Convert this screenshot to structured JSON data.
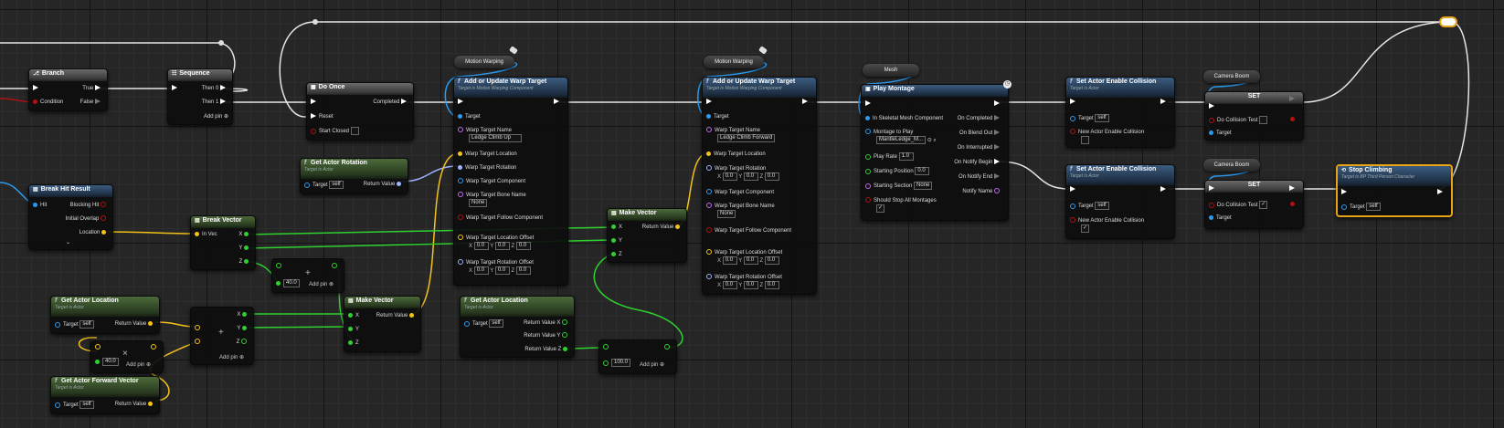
{
  "colors": {
    "exec": "#ffffff",
    "object": "#2a9bf0",
    "bool": "#b01212",
    "vector": "#f2c21b",
    "float": "#2fd12f",
    "rotator": "#a0b4ff",
    "name": "#c06cf0",
    "struct": "#2a9bf0",
    "selected": "#e8a317"
  },
  "nodes": {
    "branch": {
      "title": "Branch",
      "pins": {
        "true": "True",
        "false": "False",
        "condition": "Condition"
      }
    },
    "sequence": {
      "title": "Sequence",
      "pins": {
        "then0": "Then 0",
        "then1": "Then 1"
      },
      "add_pin": "Add pin"
    },
    "do_once": {
      "title": "Do Once",
      "pins": {
        "completed": "Completed",
        "reset": "Reset",
        "start_closed": "Start Closed"
      }
    },
    "break_hit": {
      "title": "Break Hit Result",
      "pins": {
        "hit": "Hit",
        "blocking": "Blocking Hit",
        "overlap": "Initial Overlap",
        "location": "Location"
      }
    },
    "break_vector": {
      "title": "Break Vector",
      "pins": {
        "in_vec": "In Vec",
        "x": "X",
        "y": "Y",
        "z": "Z"
      }
    },
    "get_rotation": {
      "title": "Get Actor Rotation",
      "subtitle": "Target is Actor",
      "pins": {
        "target": "Target",
        "target_val": "self",
        "ret": "Return Value"
      }
    },
    "add_float": {
      "value": "40.0",
      "add_pin": "Add pin"
    },
    "get_location": {
      "title": "Get Actor Location",
      "subtitle": "Target is Actor",
      "pins": {
        "target": "Target",
        "target_val": "self",
        "ret": "Return Value"
      }
    },
    "add_vector": {
      "glyph": "+",
      "pins": {
        "x": "X",
        "y": "Y",
        "z": "Z"
      },
      "add_pin": "Add pin"
    },
    "mul_float": {
      "value": "40.0",
      "add_pin": "Add pin"
    },
    "get_forward": {
      "title": "Get Actor Forward Vector",
      "subtitle": "Target is Actor",
      "pins": {
        "target": "Target",
        "target_val": "self",
        "ret": "Return Value"
      }
    },
    "make_vector1": {
      "title": "Make Vector",
      "pins": {
        "x": "X",
        "y": "Y",
        "z": "Z",
        "ret": "Return Value"
      }
    },
    "motion1": {
      "label": "Motion Warping"
    },
    "warp1": {
      "title": "Add or Update Warp Target",
      "subtitle": "Target is Motion Warping Component",
      "pins": {
        "target": "Target",
        "name_lbl": "Warp Target Name",
        "name_val": "Ledge Climb Up",
        "loc": "Warp Target Location",
        "rot": "Warp Target Rotation",
        "comp": "Warp Target Component",
        "bone_lbl": "Warp Target Bone Name",
        "bone_val": "None",
        "follow": "Warp Target Follow Component",
        "loc_off": "Warp Target Location Offset",
        "rot_off": "Warp Target Rotation Offset",
        "x": "X",
        "y": "Y",
        "z": "Z",
        "zero": "0.0"
      }
    },
    "make_vector2": {
      "title": "Make Vector",
      "pins": {
        "x": "X",
        "y": "Y",
        "z": "Z",
        "ret": "Return Value"
      }
    },
    "get_location2": {
      "title": "Get Actor Location",
      "subtitle": "Target is Actor",
      "pins": {
        "target": "Target",
        "target_val": "self",
        "rx": "Return Value X",
        "ry": "Return Value Y",
        "rz": "Return Value Z"
      }
    },
    "add_float2": {
      "value": "100.0",
      "add_pin": "Add pin"
    },
    "motion2": {
      "label": "Motion Warping"
    },
    "warp2": {
      "title": "Add or Update Warp Target",
      "subtitle": "Target is Motion Warping Component",
      "pins": {
        "target": "Target",
        "name_lbl": "Warp Target Name",
        "name_val": "Ledge Climb Forward",
        "loc": "Warp Target Location",
        "rot": "Warp Target Rotation",
        "comp": "Warp Target Component",
        "bone_lbl": "Warp Target Bone Name",
        "bone_val": "None",
        "follow": "Warp Target Follow Component",
        "loc_off": "Warp Target Location Offset",
        "rot_off": "Warp Target Rotation Offset",
        "x": "X",
        "y": "Y",
        "z": "Z",
        "zero": "0.0"
      }
    },
    "mesh": {
      "label": "Mesh"
    },
    "play_montage": {
      "title": "Play Montage",
      "pins": {
        "mesh": "In Skeletal Mesh Component",
        "montage_lbl": "Montage to Play",
        "montage_val": "MantleLedge_M...",
        "rate_lbl": "Play Rate",
        "rate_val": "1.0",
        "start_lbl": "Starting Position",
        "start_val": "0.0",
        "section_lbl": "Starting Section",
        "section_val": "None",
        "stop_lbl": "Should Stop All Montages",
        "completed": "On Completed",
        "blend": "On Blend Out",
        "interrupted": "On Interrupted",
        "notify_begin": "On Notify Begin",
        "notify_end": "On Notify End",
        "notify_name": "Notify Name"
      }
    },
    "collision1": {
      "title": "Set Actor Enable Collision",
      "subtitle": "Target is Actor",
      "pins": {
        "target": "Target",
        "target_val": "self",
        "new": "New Actor Enable Collision"
      }
    },
    "camera1": {
      "label": "Camera Boom"
    },
    "set1": {
      "title": "SET",
      "pins": {
        "do": "Do Collision Test",
        "target": "Target"
      }
    },
    "collision2": {
      "title": "Set Actor Enable Collision",
      "subtitle": "Target is Actor",
      "pins": {
        "target": "Target",
        "target_val": "self",
        "new": "New Actor Enable Collision"
      }
    },
    "camera2": {
      "label": "Camera Boom"
    },
    "set2": {
      "title": "SET",
      "pins": {
        "do": "Do Collision Test",
        "target": "Target"
      }
    },
    "stop_climbing": {
      "title": "Stop Climbing",
      "subtitle": "Target is BP Third Person Character",
      "pins": {
        "target": "Target",
        "target_val": "self"
      }
    }
  }
}
